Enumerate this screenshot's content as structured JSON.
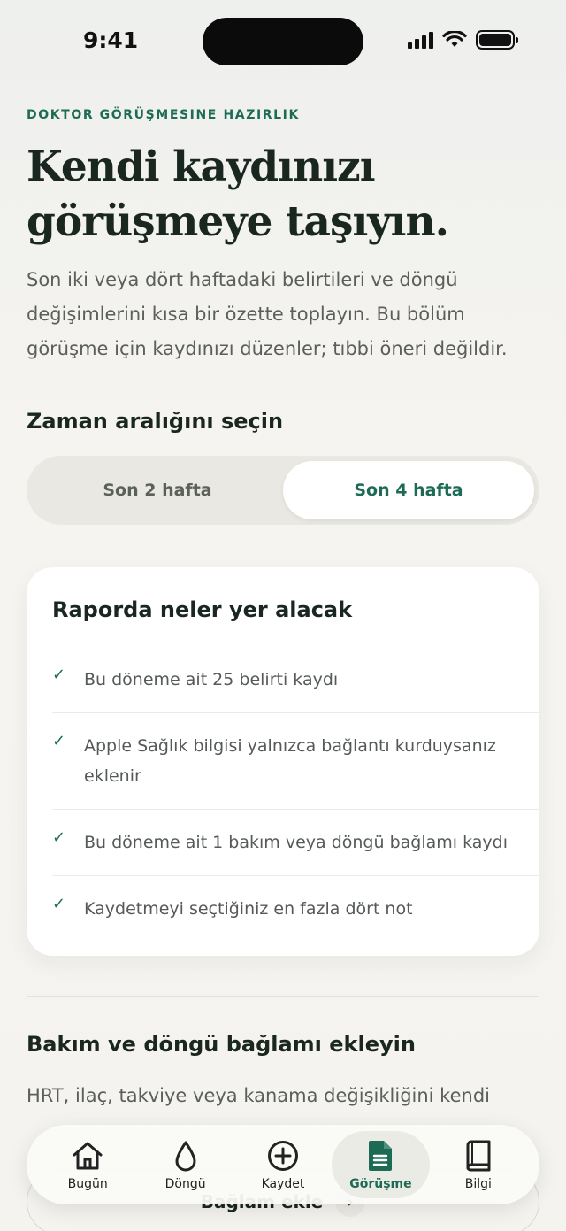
{
  "status_bar": {
    "time": "9:41"
  },
  "header": {
    "eyebrow": "DOKTOR GÖRÜŞMESINE HAZIRLIK",
    "title_line1": "Kendi kaydınızı",
    "title_line2": "görüşmeye taşıyın.",
    "intro": "Son iki veya dört haftadaki belirtileri ve döngü değişimlerini kısa bir özette toplayın. Bu bölüm görüşme için kaydınızı düzenler; tıbbi öneri değildir."
  },
  "range": {
    "title": "Zaman aralığını seçin",
    "options": [
      "Son 2 hafta",
      "Son 4 hafta"
    ],
    "selected": "Son 4 hafta"
  },
  "report": {
    "title": "Raporda neler yer alacak",
    "items": [
      "Bu döneme ait 25 belirti kaydı",
      "Apple Sağlık bilgisi yalnızca bağlantı kurduysanız eklenir",
      "Bu döneme ait 1 bakım veya döngü bağlamı kaydı",
      "Kaydetmeyi seçtiğiniz en fazla dört not"
    ]
  },
  "context": {
    "title": "Bakım ve döngü bağlamı ekleyin",
    "text": "HRT, ilaç, takviye veya kanama değişikliğini kendi",
    "button_label": "Bağlam ekle"
  },
  "tabbar": {
    "items": [
      {
        "label": "Bugün",
        "icon": "home-icon"
      },
      {
        "label": "Döngü",
        "icon": "drop-icon"
      },
      {
        "label": "Kaydet",
        "icon": "plus-circle-icon"
      },
      {
        "label": "Görüşme",
        "icon": "document-icon"
      },
      {
        "label": "Bilgi",
        "icon": "book-icon"
      }
    ],
    "active": "Görüşme"
  },
  "colors": {
    "accent": "#1e6b55",
    "background": "#f5f3ef"
  }
}
